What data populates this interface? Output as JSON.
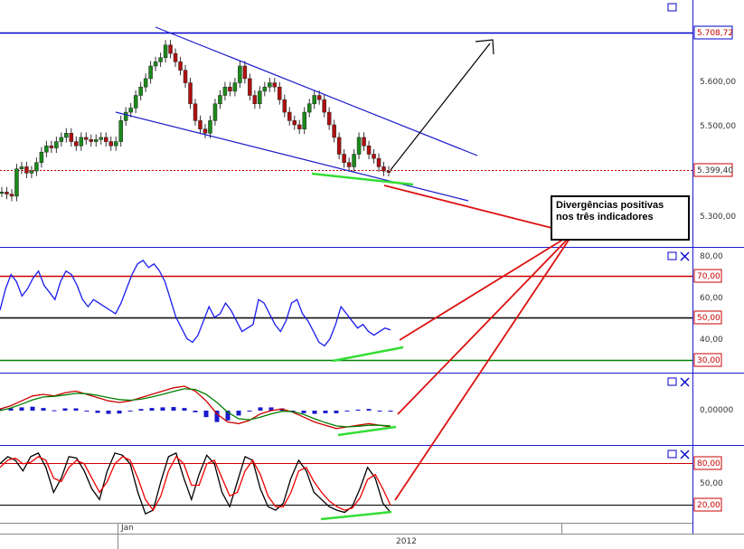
{
  "chart_data": [
    {
      "type": "candlestick",
      "title": "",
      "y_ticks": [
        "5.600,00",
        "5.500,00",
        "5.300,00"
      ],
      "ylim": [
        5230,
        5790
      ],
      "markers": [
        {
          "label": "5.708,72",
          "value": 5708.72,
          "color": "#0000cc"
        },
        {
          "label": "5.399,40",
          "value": 5399.4,
          "color": "#cc0000"
        }
      ],
      "close": [
        5350,
        5345,
        5340,
        5405,
        5410,
        5395,
        5400,
        5420,
        5445,
        5460,
        5455,
        5470,
        5480,
        5490,
        5470,
        5460,
        5480,
        5475,
        5470,
        5475,
        5480,
        5470,
        5460,
        5470,
        5520,
        5540,
        5550,
        5580,
        5600,
        5620,
        5650,
        5660,
        5670,
        5700,
        5680,
        5660,
        5640,
        5610,
        5560,
        5520,
        5500,
        5490,
        5520,
        5560,
        5580,
        5600,
        5590,
        5610,
        5650,
        5620,
        5580,
        5560,
        5590,
        5600,
        5610,
        5600,
        5570,
        5540,
        5520,
        5510,
        5500,
        5540,
        5560,
        5580,
        5570,
        5540,
        5510,
        5480,
        5440,
        5420,
        5410,
        5440,
        5480,
        5460,
        5440,
        5430,
        5410,
        5400,
        5399
      ]
    },
    {
      "type": "line",
      "indicator": "RSI",
      "y_ticks": [
        "80,00",
        "60,00",
        "40,00"
      ],
      "levels": [
        {
          "label": "70,00",
          "value": 70,
          "color": "#cc0000"
        },
        {
          "label": "50,00",
          "value": 50,
          "color": "#000000"
        },
        {
          "label": "30,00",
          "value": 30,
          "color": "#008000"
        }
      ],
      "ylim": [
        18,
        82
      ],
      "values": [
        50,
        62,
        70,
        66,
        58,
        62,
        68,
        72,
        64,
        60,
        56,
        66,
        72,
        70,
        64,
        56,
        52,
        56,
        54,
        52,
        50,
        48,
        54,
        62,
        70,
        76,
        78,
        74,
        76,
        72,
        66,
        56,
        46,
        40,
        34,
        32,
        36,
        44,
        52,
        46,
        48,
        54,
        50,
        44,
        38,
        40,
        42,
        56,
        54,
        48,
        42,
        38,
        44,
        54,
        56,
        48,
        44,
        38,
        32,
        30,
        34,
        42,
        52,
        48,
        44,
        40,
        42,
        38,
        36,
        38,
        40,
        39
      ]
    },
    {
      "type": "line",
      "indicator": "MACD",
      "y_ticks": [
        "0,00000"
      ],
      "ylim": [
        -1,
        1
      ],
      "series": [
        {
          "color": "#cc0000",
          "values": [
            0.05,
            0.15,
            0.3,
            0.45,
            0.5,
            0.45,
            0.55,
            0.6,
            0.5,
            0.4,
            0.3,
            0.25,
            0.3,
            0.4,
            0.5,
            0.6,
            0.7,
            0.75,
            0.6,
            0.3,
            -0.1,
            -0.35,
            -0.4,
            -0.3,
            -0.1,
            0.0,
            0.05,
            -0.05,
            -0.2,
            -0.35,
            -0.45,
            -0.55,
            -0.5,
            -0.45,
            -0.4,
            -0.45,
            -0.5
          ]
        },
        {
          "color": "#008000",
          "values": [
            0.0,
            0.08,
            0.2,
            0.33,
            0.42,
            0.44,
            0.48,
            0.53,
            0.52,
            0.47,
            0.4,
            0.34,
            0.32,
            0.35,
            0.42,
            0.5,
            0.59,
            0.67,
            0.65,
            0.5,
            0.25,
            -0.05,
            -0.25,
            -0.28,
            -0.2,
            -0.1,
            -0.02,
            -0.03,
            -0.12,
            -0.25,
            -0.37,
            -0.47,
            -0.5,
            -0.48,
            -0.45,
            -0.45,
            -0.47
          ]
        }
      ],
      "histogram": [
        0.05,
        0.07,
        0.1,
        0.12,
        0.08,
        0.01,
        0.07,
        0.07,
        -0.02,
        -0.07,
        -0.1,
        -0.09,
        -0.02,
        0.05,
        0.08,
        0.1,
        0.11,
        0.08,
        -0.05,
        -0.2,
        -0.35,
        -0.3,
        -0.15,
        -0.02,
        0.1,
        0.1,
        0.07,
        -0.02,
        -0.08,
        -0.1,
        -0.08,
        -0.08,
        0.0,
        0.03,
        0.05,
        0.0,
        -0.03
      ]
    },
    {
      "type": "line",
      "indicator": "Stochastic",
      "y_ticks": [
        "50,00"
      ],
      "levels": [
        {
          "label": "80,00",
          "value": 80,
          "color": "#cc0000"
        },
        {
          "label": "20,00",
          "value": 20,
          "color": "#000000"
        }
      ],
      "ylim": [
        0,
        100
      ],
      "series": [
        {
          "color": "#000000",
          "values": [
            80,
            90,
            85,
            70,
            90,
            95,
            75,
            40,
            60,
            90,
            88,
            70,
            45,
            30,
            70,
            95,
            92,
            80,
            40,
            10,
            15,
            55,
            90,
            95,
            60,
            30,
            65,
            92,
            80,
            40,
            20,
            55,
            90,
            85,
            45,
            20,
            15,
            25,
            60,
            85,
            70,
            40,
            30,
            20,
            15,
            12,
            20,
            45,
            75,
            60,
            25,
            12
          ]
        },
        {
          "color": "#cc0000",
          "values": [
            75,
            85,
            88,
            80,
            82,
            90,
            85,
            60,
            55,
            75,
            85,
            80,
            60,
            40,
            55,
            80,
            90,
            85,
            60,
            30,
            15,
            35,
            70,
            90,
            80,
            50,
            50,
            80,
            85,
            60,
            35,
            40,
            70,
            85,
            65,
            35,
            20,
            20,
            40,
            70,
            75,
            55,
            40,
            28,
            20,
            15,
            18,
            32,
            58,
            65,
            45,
            22
          ]
        }
      ]
    }
  ],
  "x_axis": {
    "month_label": "Jan",
    "year_label": "2012"
  },
  "annotation": {
    "line1": "Divergências positivas",
    "line2": "nos três indicadores"
  },
  "panel_icons": [
    "maximize-icon",
    "close-icon"
  ]
}
